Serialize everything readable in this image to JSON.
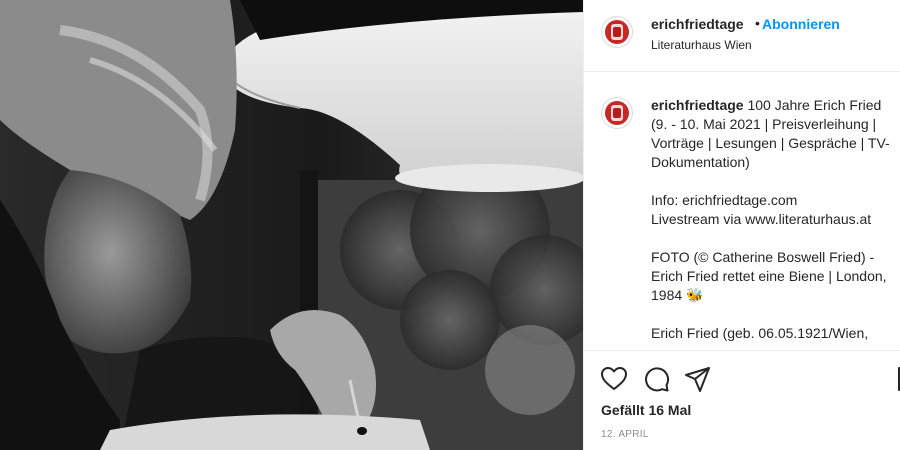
{
  "photo": {
    "alt_icon": "black-and-white-photo"
  },
  "header": {
    "username": "erichfriedtage",
    "separator": "•",
    "follow_label": "Abonnieren",
    "location": "Literaturhaus Wien",
    "avatar_icon": "profile-avatar-icon"
  },
  "caption": {
    "username": "erichfriedtage",
    "line1": "100 Jahre Erich Fried (9. - 10. Mai 2021 | Preisverleihung | Vorträge | Lesungen | Gespräche | TV-Dokumentation)",
    "info": "Info: erichfriedtage.com",
    "livestream": "Livestream via www.literaturhaus.at",
    "foto": "FOTO (© Catherine Boswell Fried) - Erich Fried rettet eine Biene | London, 1984 🐝",
    "bio": "Erich Fried (geb. 06.05.1921/Wien,"
  },
  "actions": {
    "like_icon": "heart-icon",
    "comment_icon": "comment-icon",
    "share_icon": "paper-plane-icon",
    "save_icon": "bookmark-icon",
    "likes_text": "Gefällt 16 Mal",
    "date_text": "12. APRIL"
  }
}
